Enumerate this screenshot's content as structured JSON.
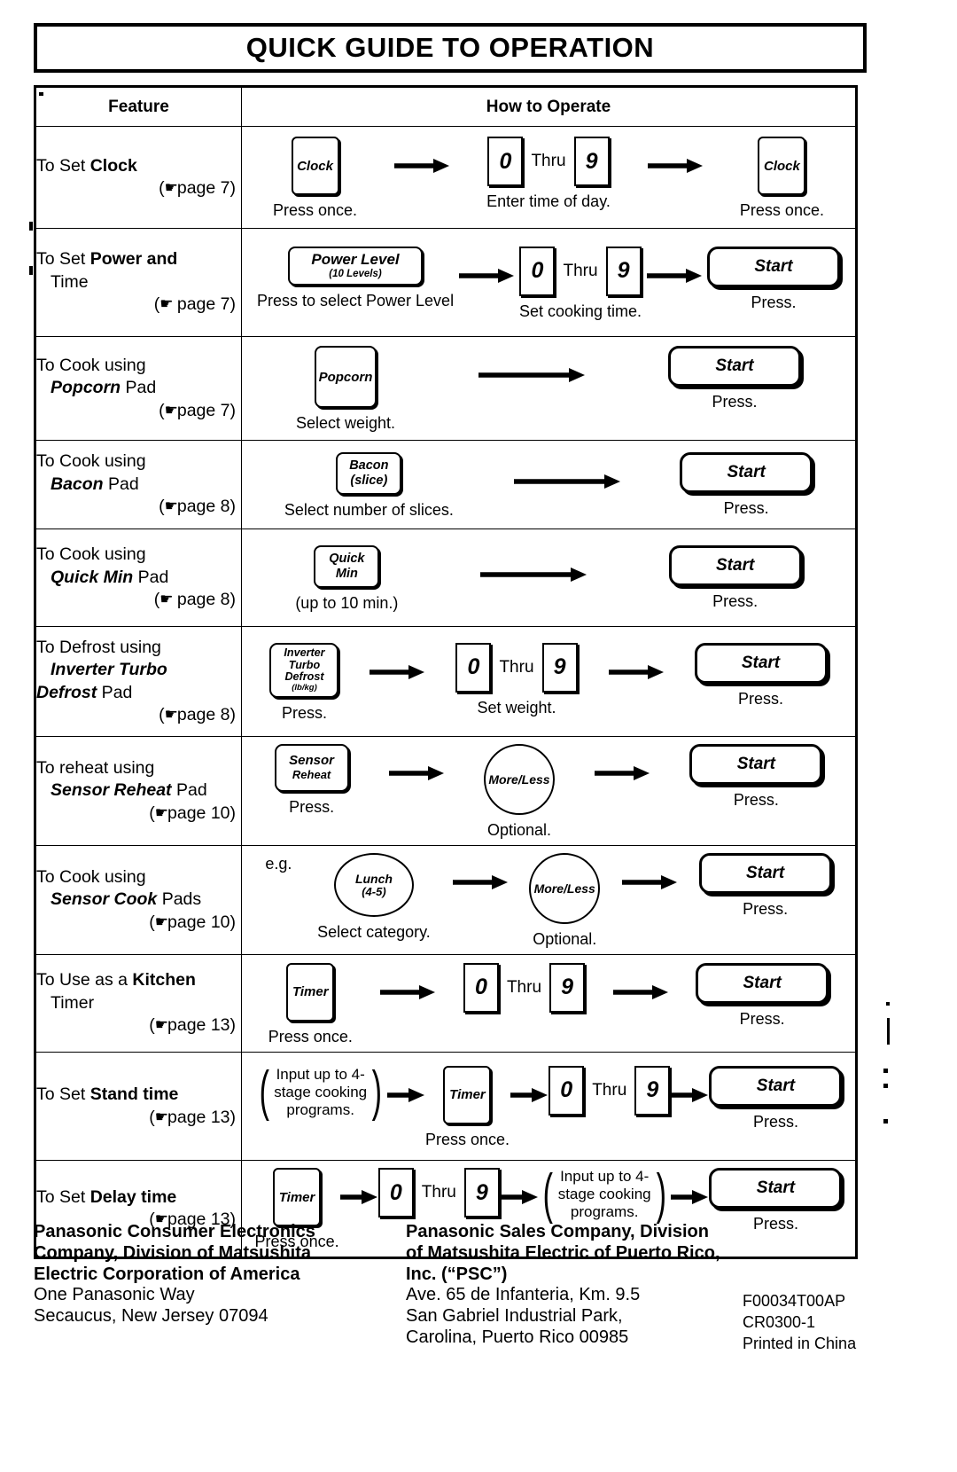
{
  "title": "QUICK GUIDE TO OPERATION",
  "table": {
    "headers": {
      "feature": "Feature",
      "how": "How to Operate"
    },
    "labels": {
      "thru": "Thru",
      "digit_low": "0",
      "digit_high": "9",
      "start": "Start",
      "press": "Press.",
      "press_once": "Press once."
    },
    "rows": [
      {
        "feature": {
          "line1": "To Set ",
          "line1_em": "Clock",
          "line2": "",
          "line3": "",
          "page": "(☛page 7)"
        },
        "steps": [
          {
            "pad": "Clock",
            "caption": "Press once."
          },
          {
            "range": true,
            "caption": "Enter time of day."
          },
          {
            "pad": "Clock",
            "caption": "Press once."
          }
        ]
      },
      {
        "feature": {
          "line1": "To Set ",
          "line1_em": "Power and",
          "line2": "Time",
          "line3": "",
          "page": "(☛ page 7)"
        },
        "steps": [
          {
            "pad": "Power Level",
            "pad_sub": "(10 Levels)",
            "caption": "Press to select Power Level"
          },
          {
            "range": true,
            "caption": "Set cooking time."
          },
          {
            "start": "Start",
            "caption": "Press."
          }
        ]
      },
      {
        "feature": {
          "line1": "To Cook using",
          "line2_em": "Popcorn",
          "line2": " Pad",
          "page": "(☛page 7)"
        },
        "steps": [
          {
            "pad": "Popcorn",
            "caption": "Select weight."
          },
          {
            "start": "Start",
            "caption": "Press."
          }
        ]
      },
      {
        "feature": {
          "line1": "To Cook using",
          "line2_em": "Bacon",
          "line2": " Pad",
          "page": "(☛page 8)"
        },
        "steps": [
          {
            "pad": "Bacon",
            "pad_sub": "(slice)",
            "caption": "Select number of slices."
          },
          {
            "start": "Start",
            "caption": "Press."
          }
        ]
      },
      {
        "feature": {
          "line1": "To Cook using",
          "line2_em": "Quick Min",
          "line2": " Pad",
          "page": "(☛ page 8)"
        },
        "steps": [
          {
            "pad": "Quick",
            "pad_sub": "Min",
            "caption": "(up to 10 min.)"
          },
          {
            "start": "Start",
            "caption": "Press."
          }
        ]
      },
      {
        "feature": {
          "line1": "To Defrost using",
          "line2_em": "Inverter Turbo",
          "line3_em": "Defrost",
          "line3": " Pad",
          "page": "(☛page 8)"
        },
        "steps": [
          {
            "pad": "Inverter",
            "pad_l2": "Turbo",
            "pad_l3": "Defrost",
            "pad_sub": "(lb/kg)",
            "caption": "Press."
          },
          {
            "range": true,
            "caption": "Set weight."
          },
          {
            "start": "Start",
            "caption": "Press."
          }
        ]
      },
      {
        "feature": {
          "line1": "To reheat using",
          "line2_em": "Sensor Reheat",
          "line2": " Pad",
          "page": "(☛page 10)"
        },
        "steps": [
          {
            "pad": "Sensor",
            "pad_l2": "Reheat",
            "caption": "Press."
          },
          {
            "circle": "More/Less",
            "caption": "Optional."
          },
          {
            "start": "Start",
            "caption": "Press."
          }
        ]
      },
      {
        "feature": {
          "line1": "To Cook using",
          "line2_em": "Sensor Cook",
          "line2": " Pads",
          "page": "(☛page 10)"
        },
        "eg": "e.g.",
        "steps": [
          {
            "oval": "Lunch",
            "oval_sub": "(4-5)",
            "caption": "Select category."
          },
          {
            "circle": "More/Less",
            "caption": "Optional."
          },
          {
            "start": "Start",
            "caption": "Press."
          }
        ]
      },
      {
        "feature": {
          "line1": "To Use as a ",
          "line1_em": "Kitchen",
          "line2": "Timer",
          "page": "(☛page 13)"
        },
        "steps": [
          {
            "pad": "Timer",
            "caption": "Press once."
          },
          {
            "range": true,
            "caption": ""
          },
          {
            "start": "Start",
            "caption": "Press."
          }
        ]
      },
      {
        "feature": {
          "line1": "To Set ",
          "line1_em": "Stand time",
          "page": "(☛page 13)"
        },
        "steps": [
          {
            "note": [
              "Input up to 4-",
              "stage cooking",
              "programs."
            ]
          },
          {
            "pad": "Timer",
            "caption": "Press once."
          },
          {
            "range": true,
            "caption": ""
          },
          {
            "start": "Start",
            "caption": "Press."
          }
        ]
      },
      {
        "feature": {
          "line1": "To Set ",
          "line1_em": "Delay time",
          "page": "(☛page 13)"
        },
        "steps": [
          {
            "pad": "Timer",
            "caption": "Press once."
          },
          {
            "range": true,
            "caption": ""
          },
          {
            "note": [
              "Input up to 4-",
              "stage cooking",
              "programs."
            ]
          },
          {
            "start": "Start",
            "caption": "Press."
          }
        ]
      }
    ]
  },
  "footer": {
    "col_a": {
      "bold": [
        "Panasonic Consumer Electronics",
        "Company, Division of Matsushita",
        "Electric Corporation of America"
      ],
      "plain": [
        "One Panasonic Way",
        "Secaucus, New Jersey 07094"
      ]
    },
    "col_b": {
      "bold": [
        "Panasonic Sales Company, Division",
        "of Matsushita Electric of Puerto Rico,",
        "Inc. (“PSC”)"
      ],
      "plain": [
        "Ave. 65 de Infanteria, Km. 9.5",
        "San Gabriel Industrial Park,",
        "Carolina, Puerto Rico 00985"
      ]
    },
    "col_c": [
      "F00034T00AP",
      "CR0300-1",
      "Printed in China"
    ]
  }
}
